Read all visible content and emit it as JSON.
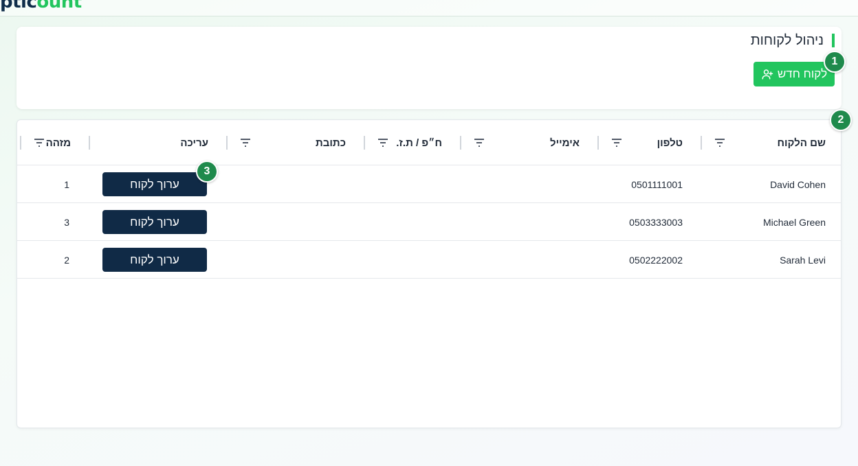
{
  "app": {
    "logo_part1": "ptic",
    "logo_part2": "ount"
  },
  "page": {
    "title": "ניהול לקוחות",
    "new_customer_label": "לקוח חדש"
  },
  "badges": [
    "1",
    "2",
    "3"
  ],
  "table": {
    "columns": {
      "name": "שם הלקוח",
      "phone": "טלפון",
      "email": "אימייל",
      "company_id": "ח״פ / ת.ז.",
      "address": "כתובת",
      "edit": "עריכה",
      "id": "מזהה"
    },
    "rows": [
      {
        "name": "David Cohen",
        "phone": "0501111001",
        "email": "",
        "company_id": "",
        "address": "",
        "edit_label": "ערוך לקוח",
        "id": "1"
      },
      {
        "name": "Michael Green",
        "phone": "0503333003",
        "email": "",
        "company_id": "",
        "address": "",
        "edit_label": "ערוך לקוח",
        "id": "3"
      },
      {
        "name": "Sarah Levi",
        "phone": "0502222002",
        "email": "",
        "company_id": "",
        "address": "",
        "edit_label": "ערוך לקוח",
        "id": "2"
      }
    ]
  },
  "icons": {
    "new_customer": "user-plus-icon",
    "filter": "filter-icon"
  },
  "colors": {
    "accent": "#22c55e",
    "primary_dark": "#102a46",
    "badge": "#1f8a4c"
  }
}
